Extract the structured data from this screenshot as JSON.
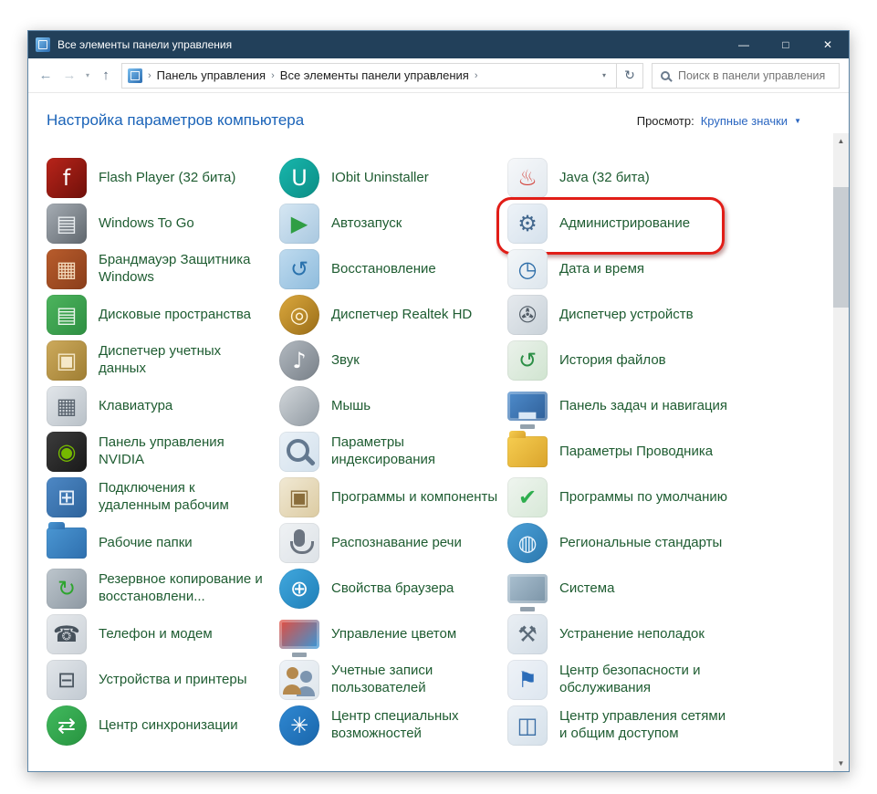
{
  "colors": {
    "titlebar": "#22405a",
    "window_border": "#5f87a8",
    "item_text": "#1e5c31",
    "link": "#1a63b8",
    "highlight": "#e11d17"
  },
  "window": {
    "title": "Все элементы панели управления",
    "controls": {
      "minimize": "—",
      "maximize": "□",
      "close": "✕"
    }
  },
  "toolbar": {
    "icons": {
      "back": "←",
      "forward": "→",
      "history_dropdown": "▾",
      "up": "↑",
      "address_dropdown": "▾",
      "refresh": "↻"
    },
    "breadcrumb": {
      "separator": "›",
      "segments": [
        "Панель управления",
        "Все элементы панели управления"
      ]
    },
    "search_placeholder": "Поиск в панели управления"
  },
  "header": {
    "title": "Настройка параметров компьютера",
    "view_label": "Просмотр:",
    "view_value": "Крупные значки",
    "view_caret": "▼"
  },
  "scrollbar": {
    "up": "▲",
    "down": "▼"
  },
  "items": [
    {
      "id": "flash-player",
      "label": "Flash Player (32 бита)",
      "icon": {
        "name": "flash-player-icon",
        "shape": "square",
        "colors": [
          "#b8241a",
          "#70100a"
        ],
        "glyph": "f",
        "glyph_color": "#ffffff"
      }
    },
    {
      "id": "iobit-uninstaller",
      "label": "IObit Uninstaller",
      "icon": {
        "name": "iobit-uninstaller-icon",
        "shape": "circle",
        "colors": [
          "#18b7ad",
          "#0b8d85"
        ],
        "glyph": "U",
        "glyph_color": "#ffffff"
      }
    },
    {
      "id": "java",
      "label": "Java (32 бита)",
      "icon": {
        "name": "java-icon",
        "shape": "square",
        "colors": [
          "#f6f8fa",
          "#e3e9ef"
        ],
        "glyph": "♨",
        "glyph_color": "#d2413a"
      }
    },
    {
      "id": "windows-to-go",
      "label": "Windows To Go",
      "icon": {
        "name": "windows-to-go-icon",
        "shape": "square",
        "colors": [
          "#a6adb4",
          "#5f666d"
        ],
        "glyph": "▤",
        "glyph_color": "#e9edf0"
      }
    },
    {
      "id": "autoplay",
      "label": "Автозапуск",
      "icon": {
        "name": "autoplay-icon",
        "shape": "square",
        "colors": [
          "#d6e7f3",
          "#a9c8e0"
        ],
        "glyph": "▶",
        "glyph_color": "#2f9e44"
      }
    },
    {
      "id": "administrative-tools",
      "label": "Администрирование",
      "highlighted": true,
      "icon": {
        "name": "administrative-tools-icon",
        "shape": "square",
        "colors": [
          "#eef3f8",
          "#d5e1ec"
        ],
        "glyph": "⚙",
        "glyph_color": "#44698f"
      }
    },
    {
      "id": "windows-defender-firewall",
      "label": "Брандмауэр Защитника Windows",
      "icon": {
        "name": "firewall-icon",
        "shape": "square",
        "colors": [
          "#b85c2c",
          "#8a3e1a"
        ],
        "glyph": "▦",
        "glyph_color": "#f3d9ba"
      }
    },
    {
      "id": "recovery",
      "label": "Восстановление",
      "icon": {
        "name": "recovery-icon",
        "shape": "square",
        "colors": [
          "#bfdbef",
          "#8fbcdd"
        ],
        "glyph": "↺",
        "glyph_color": "#2a72ad"
      }
    },
    {
      "id": "date-time",
      "label": "Дата и время",
      "icon": {
        "name": "date-time-icon",
        "shape": "square",
        "colors": [
          "#f4f7f9",
          "#dde6ed"
        ],
        "glyph": "◷",
        "glyph_color": "#2d6da8"
      }
    },
    {
      "id": "storage-spaces",
      "label": "Дисковые пространства",
      "icon": {
        "name": "storage-spaces-icon",
        "shape": "square",
        "colors": [
          "#4db45e",
          "#2e8f42"
        ],
        "glyph": "▤",
        "glyph_color": "#eaf6ec"
      }
    },
    {
      "id": "realtek-hd-manager",
      "label": "Диспетчер Realtek HD",
      "icon": {
        "name": "realtek-hd-icon",
        "shape": "circle",
        "colors": [
          "#dca93e",
          "#996c17"
        ],
        "glyph": "◎",
        "glyph_color": "#fff3d6"
      }
    },
    {
      "id": "device-manager",
      "label": "Диспетчер устройств",
      "icon": {
        "name": "device-manager-icon",
        "shape": "square",
        "colors": [
          "#e6eaee",
          "#c9d2d9"
        ],
        "glyph": "✇",
        "glyph_color": "#515c66"
      }
    },
    {
      "id": "credential-manager",
      "label": "Диспетчер учетных данных",
      "icon": {
        "name": "credential-manager-icon",
        "shape": "square",
        "colors": [
          "#cdaa5c",
          "#9f7e33"
        ],
        "glyph": "▣",
        "glyph_color": "#f5e8c9"
      }
    },
    {
      "id": "sound",
      "label": "Звук",
      "icon": {
        "name": "sound-icon",
        "shape": "circle",
        "colors": [
          "#b3bac1",
          "#777f87"
        ],
        "glyph": "♪",
        "glyph_color": "#ffffff"
      }
    },
    {
      "id": "file-history",
      "label": "История файлов",
      "icon": {
        "name": "file-history-icon",
        "shape": "square",
        "colors": [
          "#ebf2eb",
          "#d0e4d0"
        ],
        "glyph": "↺",
        "glyph_color": "#2c8f46"
      }
    },
    {
      "id": "keyboard",
      "label": "Клавиатура",
      "icon": {
        "name": "keyboard-icon",
        "shape": "square",
        "colors": [
          "#e2e6ea",
          "#b9c1c8"
        ],
        "glyph": "▦",
        "glyph_color": "#59636e"
      }
    },
    {
      "id": "mouse",
      "label": "Мышь",
      "icon": {
        "name": "mouse-icon",
        "shape": "circle",
        "colors": [
          "#d2d7db",
          "#9099a1"
        ],
        "glyph": "",
        "glyph_color": "#ffffff"
      }
    },
    {
      "id": "taskbar-navigation",
      "label": "Панель задач и навигация",
      "icon": {
        "name": "taskbar-icon",
        "shape": "monitor",
        "colors": [
          "#4e8ccc",
          "#2f5f98"
        ],
        "glyph": "▂",
        "glyph_color": "#d9e7f6"
      }
    },
    {
      "id": "nvidia-control-panel",
      "label": "Панель управления NVIDIA",
      "icon": {
        "name": "nvidia-icon",
        "shape": "square",
        "colors": [
          "#3c3c3c",
          "#191919"
        ],
        "glyph": "◉",
        "glyph_color": "#76b900"
      }
    },
    {
      "id": "indexing-options",
      "label": "Параметры индексирования",
      "icon": {
        "name": "indexing-options-icon",
        "shape": "magnifier",
        "colors": [
          "#eaf1f7",
          "#d3e1ed"
        ],
        "glyph": "",
        "glyph_color": "#63788f"
      }
    },
    {
      "id": "folder-options",
      "label": "Параметры Проводника",
      "icon": {
        "name": "folder-options-icon",
        "shape": "folder",
        "colors": [
          "#f6cd50",
          "#daa42c"
        ],
        "glyph": "",
        "glyph_color": "#ffffff"
      }
    },
    {
      "id": "remote-desktop-connections",
      "label": "Подключения к удаленным рабочим",
      "icon": {
        "name": "remote-desktop-icon",
        "shape": "square",
        "colors": [
          "#4d88c5",
          "#2e639b"
        ],
        "glyph": "⊞",
        "glyph_color": "#e9f1fa"
      }
    },
    {
      "id": "programs-features",
      "label": "Программы и компоненты",
      "icon": {
        "name": "programs-features-icon",
        "shape": "square",
        "colors": [
          "#f1e9d4",
          "#dccba2"
        ],
        "glyph": "▣",
        "glyph_color": "#8a6d3b"
      }
    },
    {
      "id": "default-programs",
      "label": "Программы по умолчанию",
      "icon": {
        "name": "default-programs-icon",
        "shape": "square",
        "colors": [
          "#eff5ef",
          "#d7e8d7"
        ],
        "glyph": "✔",
        "glyph_color": "#2eae4e"
      }
    },
    {
      "id": "work-folders",
      "label": "Рабочие папки",
      "icon": {
        "name": "work-folders-icon",
        "shape": "folder",
        "colors": [
          "#4a96d2",
          "#2f6fae"
        ],
        "glyph": "",
        "glyph_color": "#ffffff"
      }
    },
    {
      "id": "speech-recognition",
      "label": "Распознавание речи",
      "icon": {
        "name": "speech-recognition-icon",
        "shape": "mic",
        "colors": [
          "#eff2f4",
          "#dde2e7"
        ],
        "glyph": "",
        "glyph_color": "#6b7480"
      }
    },
    {
      "id": "region",
      "label": "Региональные стандарты",
      "icon": {
        "name": "region-icon",
        "shape": "circle",
        "colors": [
          "#4aa0d8",
          "#2c78ae"
        ],
        "glyph": "◍",
        "glyph_color": "#e9f4fd"
      }
    },
    {
      "id": "backup-restore",
      "label": "Резервное копирование и восстановлени...",
      "icon": {
        "name": "backup-restore-icon",
        "shape": "square",
        "colors": [
          "#bdc6cd",
          "#8d98a2"
        ],
        "glyph": "↻",
        "glyph_color": "#2ea52e"
      }
    },
    {
      "id": "internet-options",
      "label": "Свойства браузера",
      "icon": {
        "name": "internet-options-icon",
        "shape": "circle",
        "colors": [
          "#41a8de",
          "#1f7fb8"
        ],
        "glyph": "⊕",
        "glyph_color": "#ffffff"
      }
    },
    {
      "id": "system",
      "label": "Система",
      "icon": {
        "name": "system-icon",
        "shape": "monitor",
        "colors": [
          "#abc1d1",
          "#7a93a6"
        ],
        "glyph": "",
        "glyph_color": "#ffffff"
      }
    },
    {
      "id": "phone-modem",
      "label": "Телефон и модем",
      "icon": {
        "name": "phone-modem-icon",
        "shape": "square",
        "colors": [
          "#e7eaed",
          "#ccd2d8"
        ],
        "glyph": "☎",
        "glyph_color": "#47525c"
      }
    },
    {
      "id": "color-management",
      "label": "Управление цветом",
      "icon": {
        "name": "color-management-icon",
        "shape": "monitor",
        "colors": [
          "#e74c3c",
          "#3498db"
        ],
        "glyph": "",
        "glyph_color": "#ffffff"
      }
    },
    {
      "id": "troubleshooting",
      "label": "Устранение неполадок",
      "icon": {
        "name": "troubleshooting-icon",
        "shape": "square",
        "colors": [
          "#eaeff4",
          "#d3dde6"
        ],
        "glyph": "⚒",
        "glyph_color": "#5b6a78"
      }
    },
    {
      "id": "devices-printers",
      "label": "Устройства и принтеры",
      "icon": {
        "name": "devices-printers-icon",
        "shape": "square",
        "colors": [
          "#e2e6ea",
          "#c2cad2"
        ],
        "glyph": "⊟",
        "glyph_color": "#4a555f"
      }
    },
    {
      "id": "user-accounts",
      "label": "Учетные записи пользователей",
      "icon": {
        "name": "user-accounts-icon",
        "shape": "users",
        "colors": [
          "#eff3f7",
          "#dfe6ec"
        ],
        "glyph": "",
        "glyph_color": "#b5894d"
      }
    },
    {
      "id": "security-maintenance",
      "label": "Центр безопасности и обслуживания",
      "icon": {
        "name": "security-maintenance-icon",
        "shape": "square",
        "colors": [
          "#eff3f8",
          "#dde6ef"
        ],
        "glyph": "⚑",
        "glyph_color": "#2b6cb8"
      }
    },
    {
      "id": "sync-center",
      "label": "Центр синхронизации",
      "icon": {
        "name": "sync-center-icon",
        "shape": "circle",
        "colors": [
          "#41ba5e",
          "#27933f"
        ],
        "glyph": "⇄",
        "glyph_color": "#ffffff"
      }
    },
    {
      "id": "ease-of-access",
      "label": "Центр специальных возможностей",
      "icon": {
        "name": "ease-of-access-icon",
        "shape": "circle",
        "colors": [
          "#2f88d2",
          "#1a66ab"
        ],
        "glyph": "✳",
        "glyph_color": "#ffffff"
      }
    },
    {
      "id": "network-sharing-center",
      "label": "Центр управления сетями и общим доступом",
      "icon": {
        "name": "network-sharing-icon",
        "shape": "square",
        "colors": [
          "#eaf0f6",
          "#d6e1ea"
        ],
        "glyph": "◫",
        "glyph_color": "#3a6ea5"
      }
    }
  ]
}
